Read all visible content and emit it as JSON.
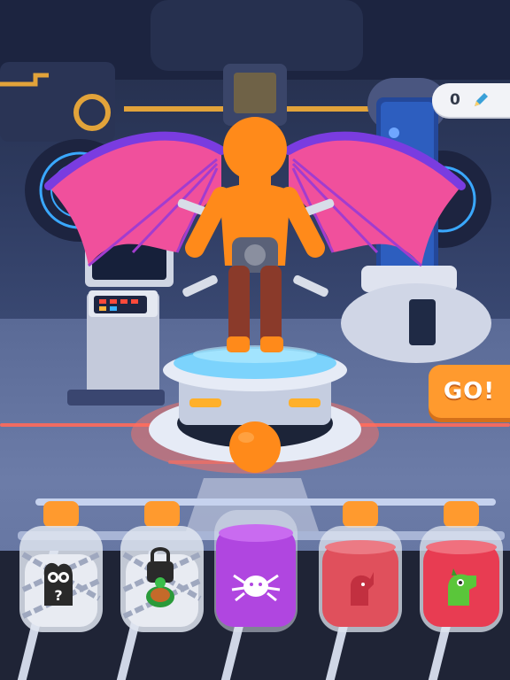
{
  "hud": {
    "score_value": "0",
    "score_icon": "pencil-icon",
    "go_label": "GO!"
  },
  "jars": [
    {
      "name": "jar-locked-dragon",
      "state": "locked",
      "icon": "dragon-mystery-icon",
      "liquid_color": "#e8ebf2",
      "label": "?"
    },
    {
      "name": "jar-locked-turtle",
      "state": "locked",
      "icon": "turtle-icon",
      "liquid_color": "#e8ebf2"
    },
    {
      "name": "jar-spider",
      "state": "unlocked",
      "icon": "spider-icon",
      "liquid_color": "#b046e0"
    },
    {
      "name": "jar-unicorn",
      "state": "unlocked",
      "icon": "unicorn-icon",
      "liquid_color": "#e0505c"
    },
    {
      "name": "jar-dragon",
      "state": "unlocked",
      "icon": "dragon-icon",
      "liquid_color": "#e83c52"
    }
  ],
  "colors": {
    "accent_orange": "#ff9a2e",
    "character_orange": "#ff8a1a",
    "wing_pink": "#f0509c",
    "wing_purple": "#7a3ce0",
    "platform_glow": "#4fc9ff"
  }
}
